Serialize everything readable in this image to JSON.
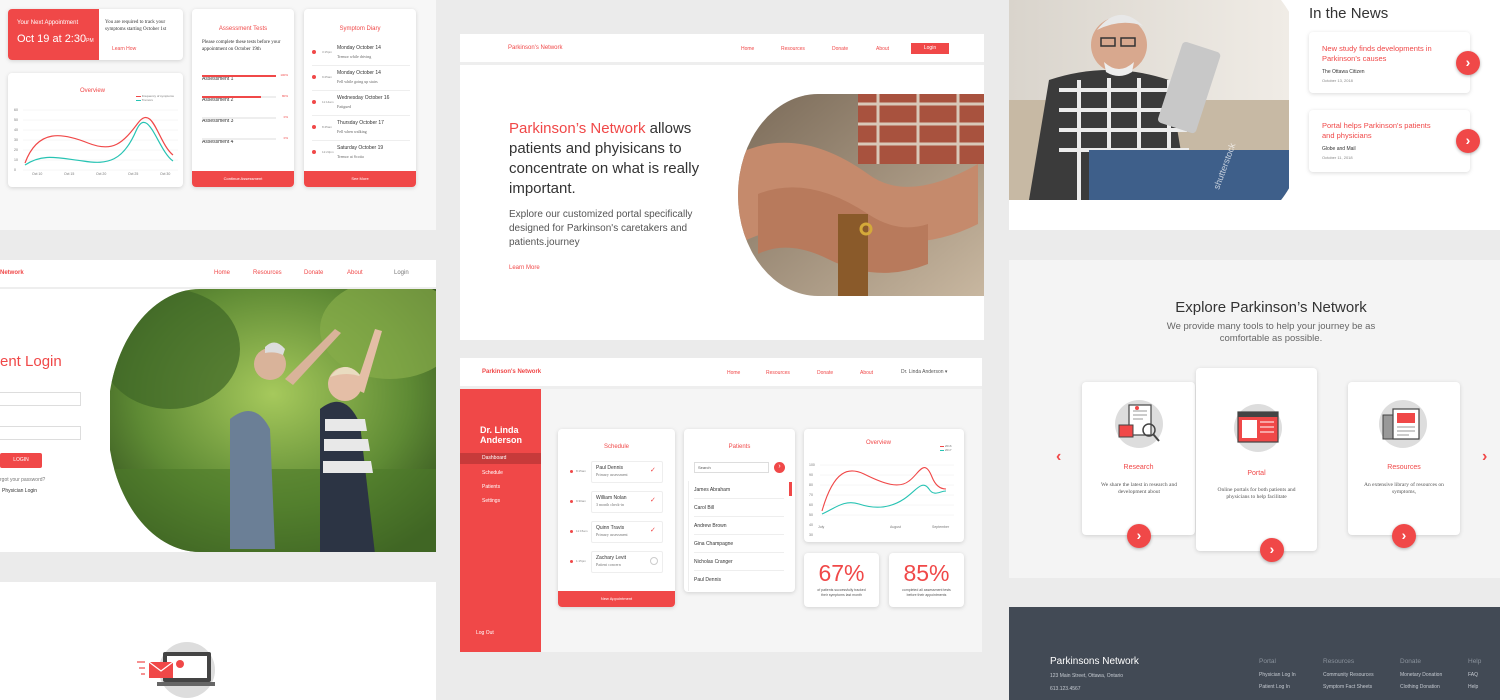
{
  "dash1": {
    "appointment": {
      "label": "Your Next Appointment",
      "date": "Oct 19 at 2:30",
      "suffix": "PM",
      "message": "You are required to track your symptoms starting October 1st",
      "link": "Learn How"
    },
    "overview": {
      "title": "Overview",
      "legend": [
        "Frequency of symptoms",
        "Tremors"
      ],
      "yticks": [
        "60",
        "50",
        "40",
        "30",
        "20",
        "10",
        "0"
      ],
      "xticks": [
        "Oct 10",
        "Oct 15",
        "Oct 20",
        "Oct 25",
        "Oct 30"
      ]
    },
    "assessment": {
      "title": "Assessment Tests",
      "desc": "Please complete these tests before your appointment on October 19th",
      "items": [
        {
          "label": "Assessment 1",
          "pct": "100%"
        },
        {
          "label": "Assessment 2",
          "pct": "80%"
        },
        {
          "label": "Assessment 3",
          "pct": "0%"
        },
        {
          "label": "Assessment 4",
          "pct": "0%"
        }
      ],
      "button": "Continue Assessment"
    },
    "diary": {
      "title": "Symptom Diary",
      "items": [
        {
          "time": "3:15pm",
          "day": "Monday October 14",
          "note": "Tremor while driving"
        },
        {
          "time": "9:25am",
          "day": "Monday October 14",
          "note": "Fell while going up stairs"
        },
        {
          "time": "11:14am",
          "day": "Wednesday October 16",
          "note": "Fatigued"
        },
        {
          "time": "8:45am",
          "day": "Thursday October 17",
          "note": "Fell when walking"
        },
        {
          "time": "12:23pm",
          "day": "Saturday October 19",
          "note": "Tremor at Scotia"
        }
      ],
      "button": "See More"
    }
  },
  "login": {
    "brand": "Network",
    "nav": [
      "Home",
      "Resources",
      "Donate",
      "About",
      "Login"
    ],
    "title": "ent Login",
    "button": "LOGIN",
    "forgot": "rgot your password?",
    "physician": "Physician Login"
  },
  "hero": {
    "brand": "Parkinson's Network",
    "nav": [
      "Home",
      "Resources",
      "Donate",
      "About",
      "Login"
    ],
    "headline_red": "Parkinson’s Network",
    "headline_rest": "allows patients and phyisicans to concentrate on what is really important.",
    "sub": "Explore our customized portal specifically designed for Parkinson's caretakers and patients.journey",
    "cta": "Learn More"
  },
  "dash2": {
    "brand": "Parkinson's Network",
    "nav": [
      "Home",
      "Resources",
      "Donate",
      "About"
    ],
    "user": "Dr. Linda Anderson",
    "sidebar": {
      "name": "Dr. Linda Anderson",
      "items": [
        "Dashboard",
        "Schedule",
        "Patients",
        "Settings"
      ],
      "logout": "Log Out"
    },
    "schedule": {
      "title": "Schedule",
      "items": [
        {
          "time": "8:15am",
          "name": "Paul Dennis",
          "type": "Primary assessment",
          "done": true
        },
        {
          "time": "9:30am",
          "name": "William Nolan",
          "type": "3 month check-in",
          "done": true
        },
        {
          "time": "11:15am",
          "name": "Quinn Travis",
          "type": "Primary assessment",
          "done": true
        },
        {
          "time": "1:15pm",
          "name": "Zachary Levit",
          "type": "Patient concern",
          "done": false
        }
      ],
      "button": "New Appointment"
    },
    "patients": {
      "title": "Patients",
      "search": "Search",
      "list": [
        "James Abraham",
        "Carol Bill",
        "Andrew Brown",
        "Gina Champagne",
        "Nicholas Cranger",
        "Paul Dennis"
      ]
    },
    "overview": {
      "title": "Overview",
      "legend": [
        "2016",
        "2017"
      ],
      "yticks": [
        "100",
        "90",
        "80",
        "70",
        "60",
        "50",
        "40",
        "30",
        "20"
      ],
      "xticks": [
        "July",
        "August",
        "September"
      ]
    },
    "stat1": {
      "value": "67%",
      "label": "of patients successfully tracked their symptoms last month"
    },
    "stat2": {
      "value": "85%",
      "label": "completed all assessment tests before their appointments"
    }
  },
  "news": {
    "title": "In the News",
    "items": [
      {
        "title": "New study finds developments in Parkinson's causes",
        "source": "The Ottawa Citizen",
        "date": "October 13, 2018"
      },
      {
        "title": "Portal helps Parkinson's patients and physicians",
        "source": "Globe and Mail",
        "date": "October 11, 2018"
      }
    ],
    "watermark": "shutterstock"
  },
  "explore": {
    "title": "Explore Parkinson’s Network",
    "sub": "We provide many tools to help your journey be as comfortable as possible.",
    "cards": [
      {
        "title": "Research",
        "desc": "We share the latest in research and development about"
      },
      {
        "title": "Portal",
        "desc": "Online portals for both patients and physicians to help facilitate"
      },
      {
        "title": "Resources",
        "desc": "An extensive library of resources on symptoms,"
      }
    ]
  },
  "footer": {
    "brand": "Parkinsons Network",
    "address": "123 Main Street, Ottawa, Ontario",
    "phone": "613.123.4567",
    "cols": [
      {
        "head": "Portal",
        "items": [
          "Physician Log In",
          "Patient Log In"
        ]
      },
      {
        "head": "Resources",
        "items": [
          "Community Resources",
          "Symptom Fact Sheets"
        ]
      },
      {
        "head": "Donate",
        "items": [
          "Monetary Donation",
          "Clothing Donation"
        ]
      },
      {
        "head": "Help",
        "items": [
          "FAQ",
          "Help"
        ]
      }
    ]
  },
  "colors": {
    "accent": "#f04848",
    "teal": "#27c3b3",
    "footer": "#424a55"
  }
}
